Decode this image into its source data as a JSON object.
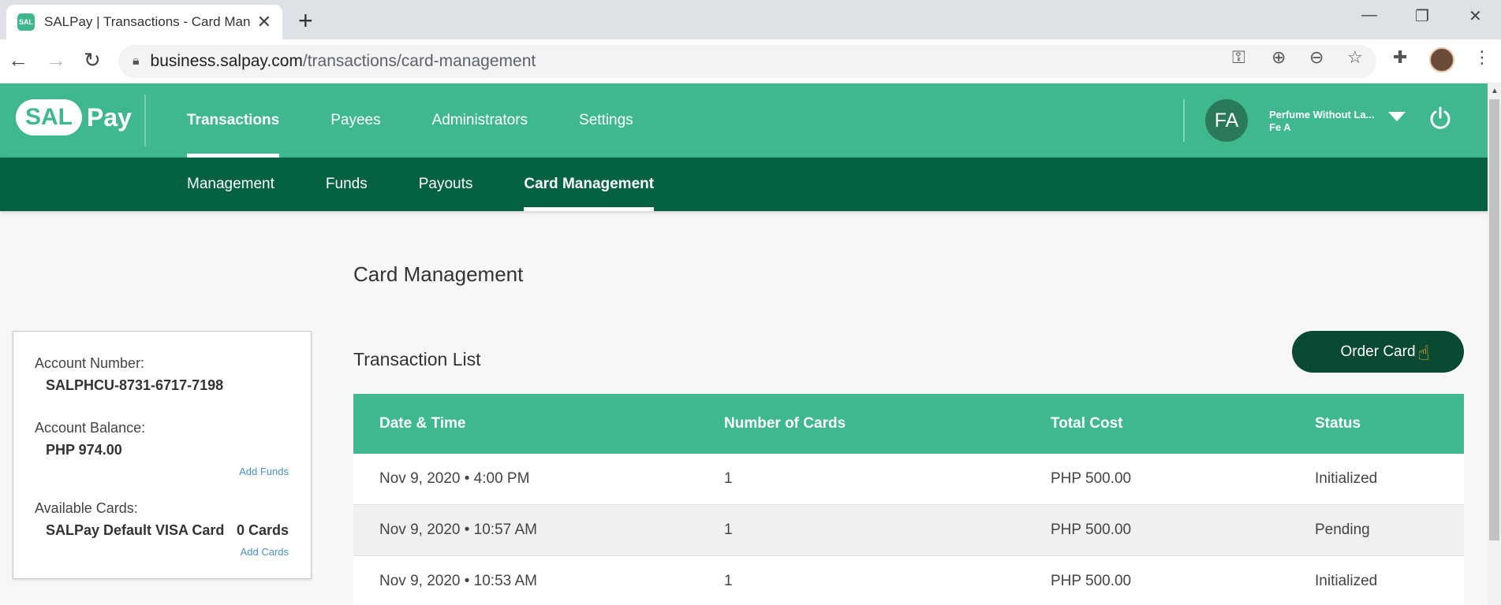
{
  "browser": {
    "tab_title": "SALPay | Transactions - Card Man",
    "favicon_text": "SAL",
    "url_host": "business.salpay.com",
    "url_path": "/transactions/card-management"
  },
  "header": {
    "logo_sal": "SAL",
    "logo_pay": "Pay",
    "nav": [
      {
        "label": "Transactions",
        "active": true
      },
      {
        "label": "Payees",
        "active": false
      },
      {
        "label": "Administrators",
        "active": false
      },
      {
        "label": "Settings",
        "active": false
      }
    ],
    "user_initials": "FA",
    "user_name": "Perfume Without La...",
    "user_sub": "Fe A"
  },
  "subnav": [
    {
      "label": "Management",
      "active": false
    },
    {
      "label": "Funds",
      "active": false
    },
    {
      "label": "Payouts",
      "active": false
    },
    {
      "label": "Card Management",
      "active": true
    }
  ],
  "account": {
    "number_label": "Account Number:",
    "number_value": "SALPHCU-8731-6717-7198",
    "balance_label": "Account Balance:",
    "balance_value": "PHP 974.00",
    "add_funds": "Add Funds",
    "cards_label": "Available Cards:",
    "cards_name": "SALPay Default VISA Card",
    "cards_count": "0 Cards",
    "add_cards": "Add Cards"
  },
  "main": {
    "page_title": "Card Management",
    "section_title": "Transaction List",
    "order_button": "Order Card"
  },
  "table": {
    "headers": [
      "Date & Time",
      "Number of Cards",
      "Total Cost",
      "Status"
    ],
    "rows": [
      [
        "Nov 9, 2020 • 4:00 PM",
        "1",
        "PHP 500.00",
        "Initialized"
      ],
      [
        "Nov 9, 2020 • 10:57 AM",
        "1",
        "PHP 500.00",
        "Pending"
      ],
      [
        "Nov 9, 2020 • 10:53 AM",
        "1",
        "PHP 500.00",
        "Initialized"
      ]
    ]
  }
}
